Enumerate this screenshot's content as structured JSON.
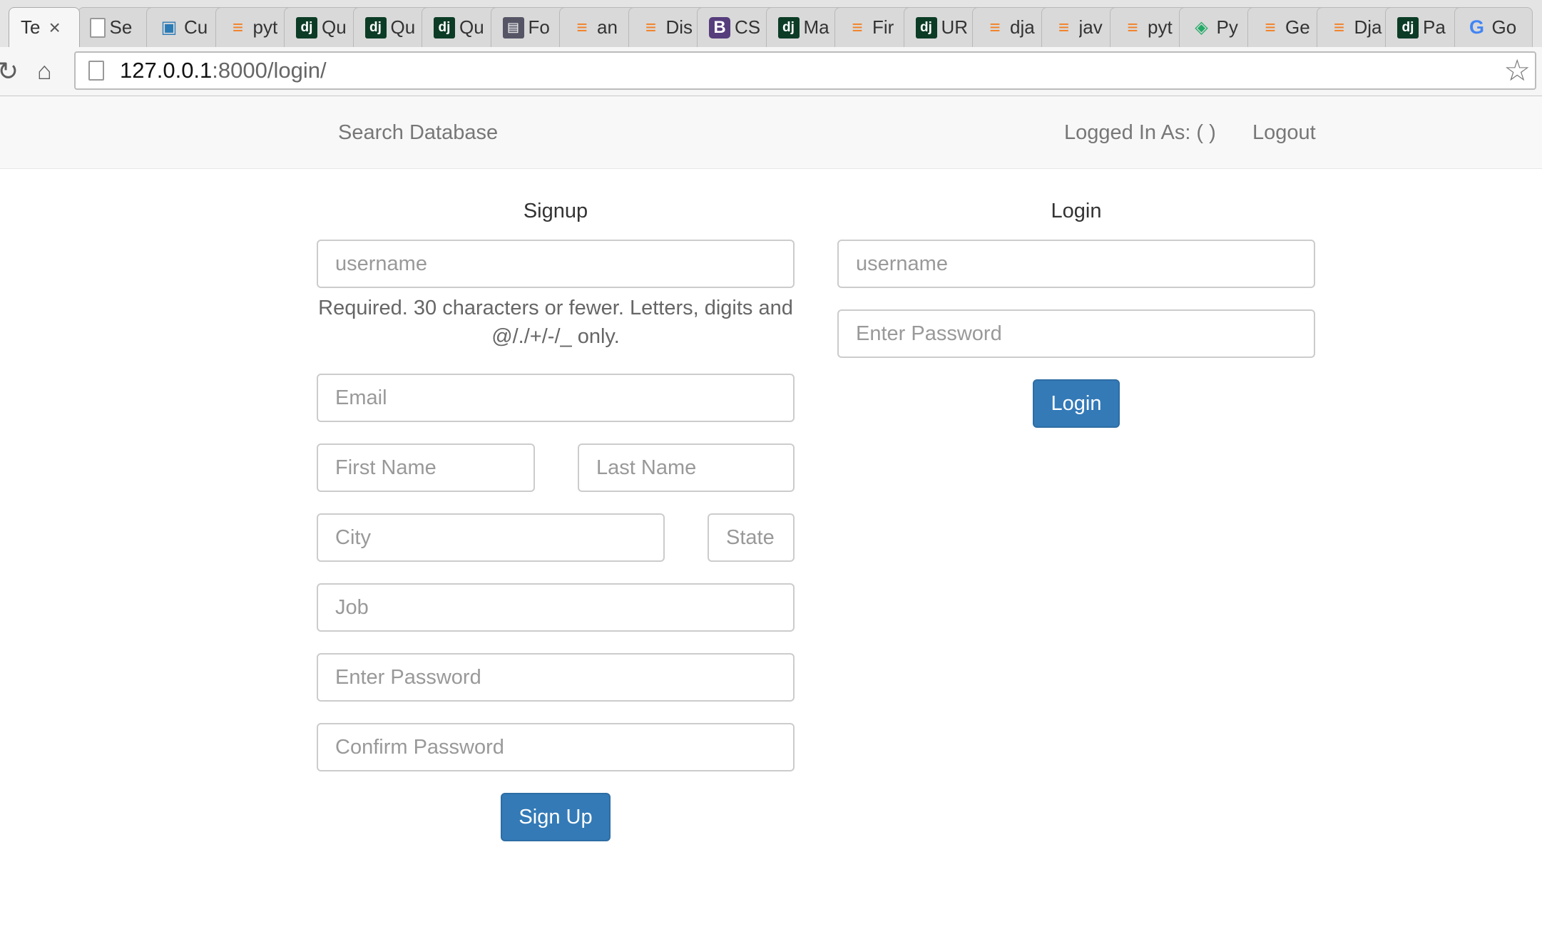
{
  "browser": {
    "tabs": [
      {
        "label": "Te",
        "icon": "none",
        "active": true
      },
      {
        "label": "Se",
        "icon": "page"
      },
      {
        "label": "Cu",
        "icon": "cu"
      },
      {
        "label": "pyt",
        "icon": "so"
      },
      {
        "label": "Qu",
        "icon": "dj"
      },
      {
        "label": "Qu",
        "icon": "dj"
      },
      {
        "label": "Qu",
        "icon": "dj"
      },
      {
        "label": "Fo",
        "icon": "fo"
      },
      {
        "label": "an",
        "icon": "so"
      },
      {
        "label": "Dis",
        "icon": "so"
      },
      {
        "label": "CS",
        "icon": "bs"
      },
      {
        "label": "Ma",
        "icon": "dj"
      },
      {
        "label": "Fir",
        "icon": "so"
      },
      {
        "label": "UR",
        "icon": "dj"
      },
      {
        "label": "dja",
        "icon": "so"
      },
      {
        "label": "jav",
        "icon": "so"
      },
      {
        "label": "pyt",
        "icon": "so"
      },
      {
        "label": "Py",
        "icon": "py"
      },
      {
        "label": "Ge",
        "icon": "so"
      },
      {
        "label": "Dja",
        "icon": "so"
      },
      {
        "label": "Pa",
        "icon": "dj"
      },
      {
        "label": "Go",
        "icon": "goo"
      }
    ],
    "url_host": "127.0.0.1",
    "url_path": ":8000/login/"
  },
  "navbar": {
    "search_link": "Search Database",
    "logged_in_label": "Logged In As: ( )",
    "logout_link": "Logout"
  },
  "signup": {
    "title": "Signup",
    "username_placeholder": "username",
    "username_help": "Required. 30 characters or fewer. Letters, digits and @/./+/-/_ only.",
    "email_placeholder": "Email",
    "first_name_placeholder": "First Name",
    "last_name_placeholder": "Last Name",
    "city_placeholder": "City",
    "state_placeholder": "State",
    "job_placeholder": "Job",
    "password_placeholder": "Enter Password",
    "confirm_password_placeholder": "Confirm Password",
    "submit_label": "Sign Up"
  },
  "login": {
    "title": "Login",
    "username_placeholder": "username",
    "password_placeholder": "Enter Password",
    "submit_label": "Login"
  },
  "colors": {
    "primary_button": "#337ab7",
    "navbar_bg": "#f8f8f8",
    "navbar_link": "#777777"
  }
}
